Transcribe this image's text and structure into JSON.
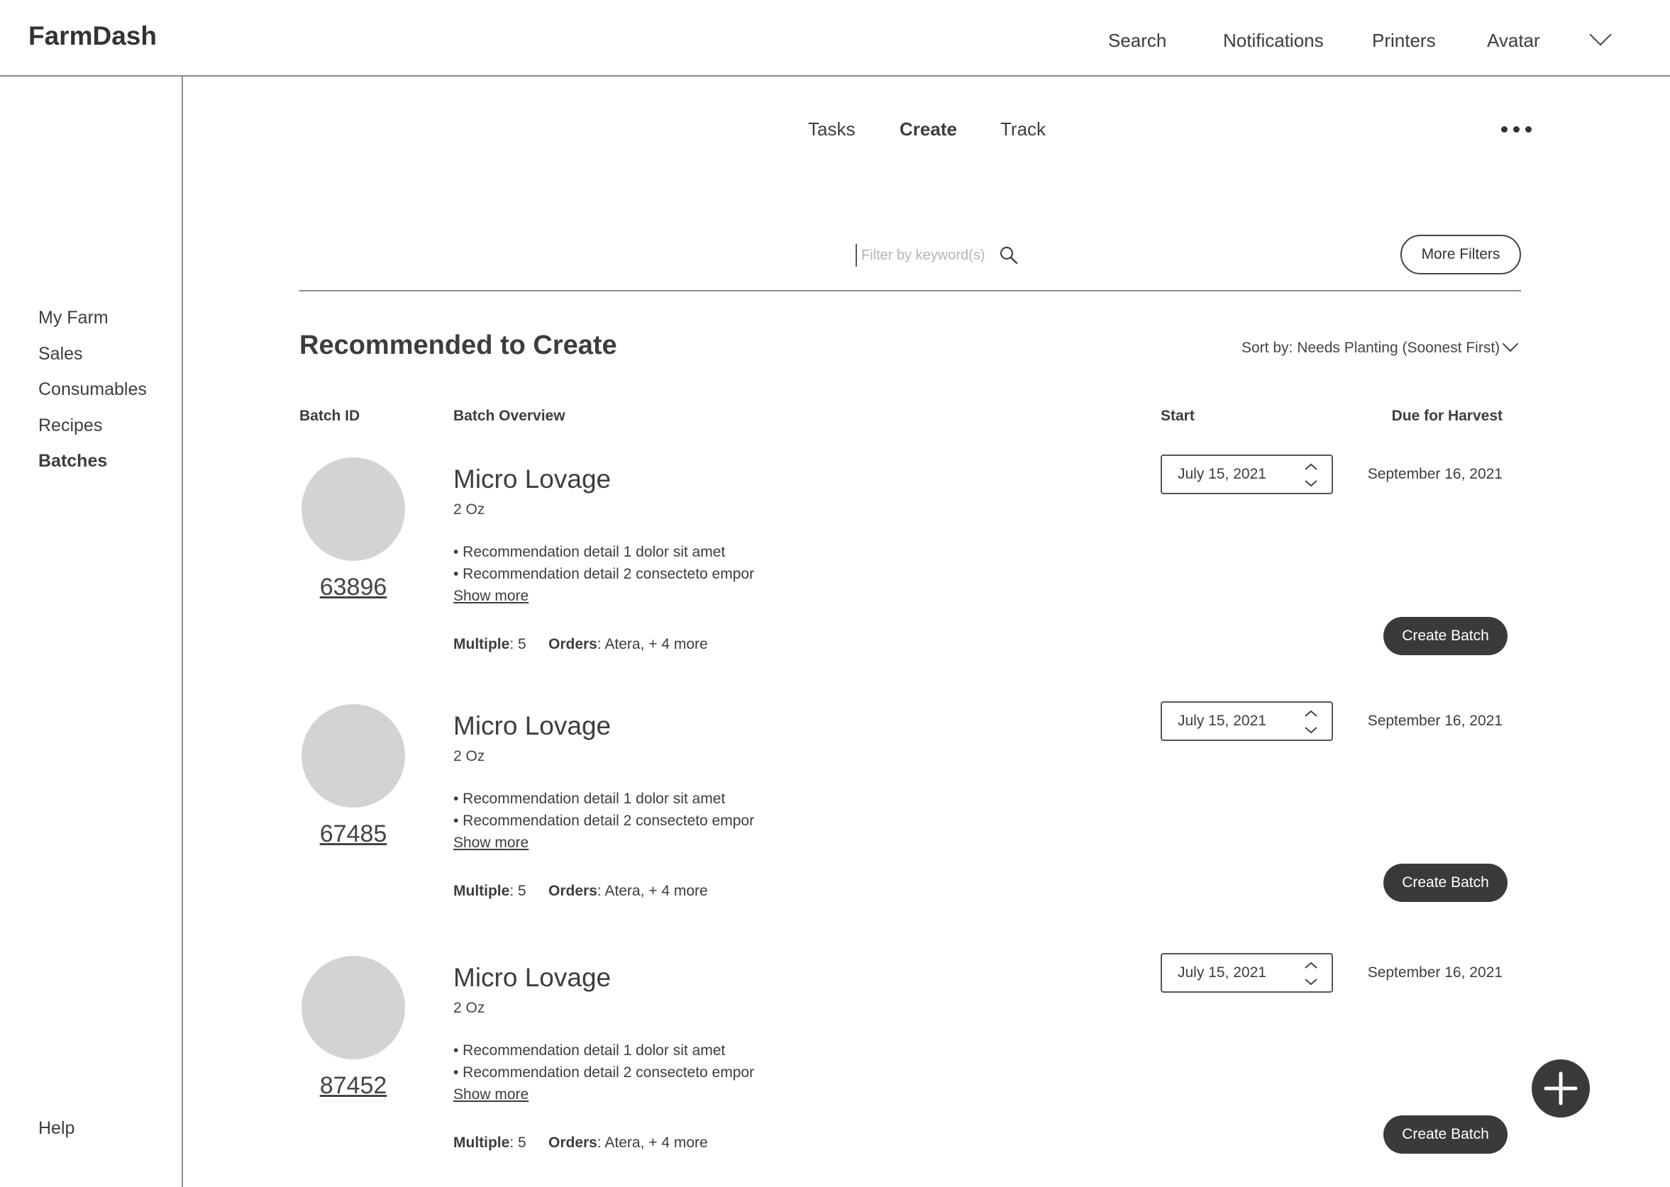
{
  "app": {
    "brand": "FarmDash"
  },
  "topnav": {
    "search": "Search",
    "notifications": "Notifications",
    "printers": "Printers",
    "avatar": "Avatar"
  },
  "sidebar": {
    "items": [
      {
        "label": "My Farm"
      },
      {
        "label": "Sales"
      },
      {
        "label": "Consumables"
      },
      {
        "label": "Recipes"
      },
      {
        "label": "Batches",
        "active": true
      }
    ],
    "help": "Help"
  },
  "tabs": [
    {
      "label": "Tasks"
    },
    {
      "label": "Create",
      "active": true
    },
    {
      "label": "Track"
    }
  ],
  "filter": {
    "placeholder": "Filter by keyword(s)",
    "more_filters": "More Filters"
  },
  "section": {
    "title": "Recommended to Create",
    "sort": "Sort by: Needs Planting (Soonest First)"
  },
  "columns": {
    "batch_id": "Batch ID",
    "overview": "Batch Overview",
    "start": "Start",
    "due": "Due for Harvest"
  },
  "labels": {
    "multiple": "Multiple",
    "orders": "Orders",
    "show_more": "Show more",
    "create_batch": "Create Batch"
  },
  "batches": [
    {
      "id": "63896",
      "name": "Micro Lovage",
      "size": "2 Oz",
      "details": [
        "• Recommendation detail 1 dolor sit amet",
        "• Recommendation detail 2 consecteto empor"
      ],
      "multiple": ": 5",
      "orders": ": Atera, + 4 more",
      "start": "July 15, 2021",
      "due": "September 16, 2021"
    },
    {
      "id": "67485",
      "name": "Micro Lovage",
      "size": "2 Oz",
      "details": [
        "• Recommendation detail 1 dolor sit amet",
        "• Recommendation detail 2 consecteto empor"
      ],
      "multiple": ": 5",
      "orders": ": Atera, + 4 more",
      "start": "July 15, 2021",
      "due": "September 16, 2021"
    },
    {
      "id": "87452",
      "name": "Micro Lovage",
      "size": "2 Oz",
      "details": [
        "• Recommendation detail 1 dolor sit amet",
        "• Recommendation detail 2 consecteto empor"
      ],
      "multiple": ": 5",
      "orders": ": Atera, + 4 more",
      "start": "July 15, 2021",
      "due": "September 16, 2021"
    }
  ],
  "icons": {
    "search": "search-icon",
    "dropdown": "chevron-down-icon",
    "more": "more-horizontal-icon",
    "stepper": "stepper-arrows-icon",
    "fab": "plus-icon"
  },
  "colors": {
    "primary_button": "#3a3a3a",
    "avatar_placeholder": "#d3d3d6",
    "divider": "#8a8a8a"
  }
}
